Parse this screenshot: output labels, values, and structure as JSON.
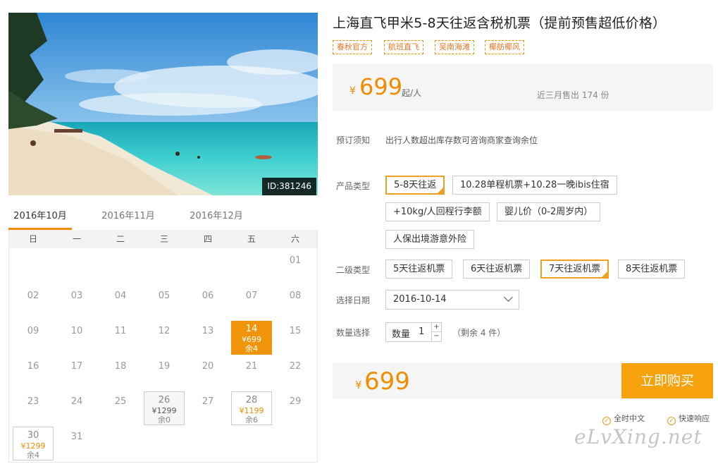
{
  "photo": {
    "id_label": "ID:381246"
  },
  "calendar": {
    "months": [
      "2016年10月",
      "2016年11月",
      "2016年12月"
    ],
    "active_month": 0,
    "weekdays": [
      "日",
      "一",
      "二",
      "三",
      "四",
      "五",
      "六"
    ],
    "days": [
      {
        "d": "01",
        "col": 6,
        "row": 0
      },
      {
        "d": "02",
        "col": 0,
        "row": 1
      },
      {
        "d": "03",
        "col": 1,
        "row": 1
      },
      {
        "d": "04",
        "col": 2,
        "row": 1
      },
      {
        "d": "05",
        "col": 3,
        "row": 1
      },
      {
        "d": "06",
        "col": 4,
        "row": 1
      },
      {
        "d": "07",
        "col": 5,
        "row": 1
      },
      {
        "d": "08",
        "col": 6,
        "row": 1
      },
      {
        "d": "09",
        "col": 0,
        "row": 2
      },
      {
        "d": "10",
        "col": 1,
        "row": 2
      },
      {
        "d": "11",
        "col": 2,
        "row": 2
      },
      {
        "d": "12",
        "col": 3,
        "row": 2
      },
      {
        "d": "13",
        "col": 4,
        "row": 2
      },
      {
        "d": "14",
        "col": 5,
        "row": 2,
        "price": "¥699",
        "remain": "余4",
        "state": "sel"
      },
      {
        "d": "15",
        "col": 6,
        "row": 2
      },
      {
        "d": "16",
        "col": 0,
        "row": 3
      },
      {
        "d": "17",
        "col": 1,
        "row": 3
      },
      {
        "d": "18",
        "col": 2,
        "row": 3
      },
      {
        "d": "19",
        "col": 3,
        "row": 3
      },
      {
        "d": "20",
        "col": 4,
        "row": 3
      },
      {
        "d": "21",
        "col": 5,
        "row": 3
      },
      {
        "d": "22",
        "col": 6,
        "row": 3
      },
      {
        "d": "23",
        "col": 0,
        "row": 4
      },
      {
        "d": "24",
        "col": 1,
        "row": 4
      },
      {
        "d": "25",
        "col": 2,
        "row": 4
      },
      {
        "d": "26",
        "col": 3,
        "row": 4,
        "price": "¥1299",
        "remain": "余0",
        "state": "avail"
      },
      {
        "d": "27",
        "col": 4,
        "row": 4
      },
      {
        "d": "28",
        "col": 5,
        "row": 4,
        "price": "¥1199",
        "remain": "余6",
        "state": "avail2"
      },
      {
        "d": "29",
        "col": 6,
        "row": 4
      },
      {
        "d": "30",
        "col": 0,
        "row": 5,
        "price": "¥1299",
        "remain": "余4",
        "state": "avail2"
      },
      {
        "d": "31",
        "col": 1,
        "row": 5
      }
    ]
  },
  "product": {
    "title": "上海直飞甲米5-8天往返含税机票（提前预售超低价格）",
    "tags": [
      "春秋官方",
      "航班直飞",
      "吴南海滩",
      "椰舫椰风"
    ],
    "price_symbol": "¥",
    "price": "699",
    "price_unit": "起/人",
    "sold_text": "近三月售出 174 份"
  },
  "booking": {
    "notice_label": "预订须知",
    "notice_text": "出行人数超出库存数可咨询商家查询余位",
    "type_label": "产品类型",
    "types": [
      "5-8天往返",
      "10.28单程机票+10.28一晚ibis住宿",
      "+10kg/人回程行李额",
      "婴儿价（0-2周岁内）",
      "人保出境游意外险"
    ],
    "subtype_label": "二级类型",
    "subtypes": [
      "5天往返机票",
      "6天往返机票",
      "7天往返机票",
      "8天往返机票"
    ],
    "date_label": "选择日期",
    "date_value": "2016-10-14",
    "qty_label": "数量选择",
    "qty_inner_label": "数量",
    "qty_value": "1",
    "qty_plus": "+",
    "qty_minus": "−",
    "stock_text": "（剩余 4 件）",
    "total_symbol": "¥",
    "total": "699",
    "buy_label": "立即购买",
    "services": [
      "全时中文",
      "快速响应"
    ]
  },
  "watermark": "eLvXing.net",
  "colors": {
    "accent": "#f08c00",
    "button": "#f5a20c"
  }
}
